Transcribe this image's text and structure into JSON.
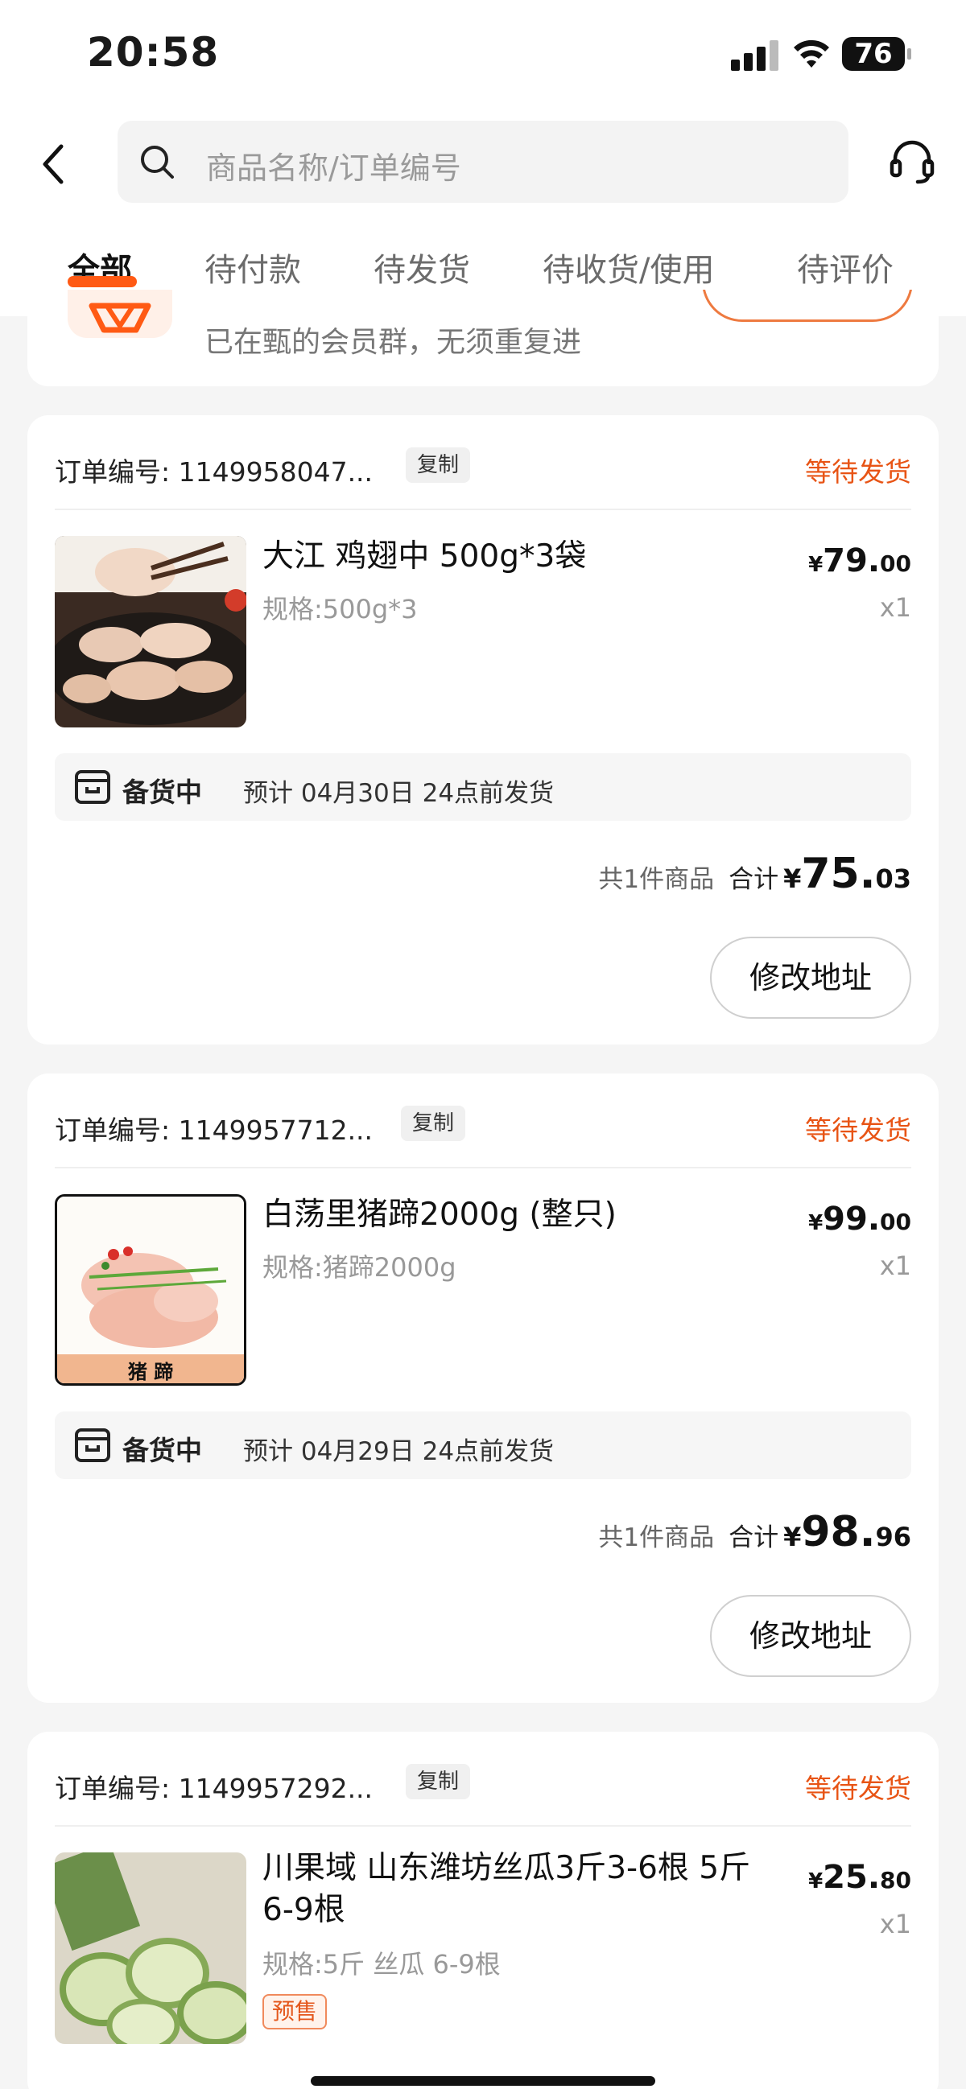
{
  "status_bar": {
    "time": "20:58",
    "battery": "76"
  },
  "search": {
    "placeholder": "商品名称/订单编号"
  },
  "tabs": [
    {
      "label": "全部",
      "active": true
    },
    {
      "label": "待付款"
    },
    {
      "label": "待发货"
    },
    {
      "label": "待收货/使用"
    },
    {
      "label": "待评价"
    }
  ],
  "member_banner": {
    "text": "已在甄的会员群，无须重复进"
  },
  "colors": {
    "accent": "#ff5a14",
    "status": "#e85415",
    "background": "#f5f5f5"
  },
  "orders": [
    {
      "order_no": "订单编号: 1149958047...",
      "copy_label": "复制",
      "status": "等待发货",
      "product": {
        "title": "大江 鸡翅中 500g*3袋",
        "spec": "规格:500g*3",
        "price_yen": "¥",
        "price_int": "79.",
        "price_cents": "00",
        "qty": "x1"
      },
      "shipping": {
        "state": "备货中",
        "eta": "预计 04月30日 24点前发货"
      },
      "summary": {
        "count": "共1件商品",
        "total_label": "合计",
        "total_yen": "¥",
        "total_int": "75.",
        "total_cents": "03"
      },
      "action": "修改地址"
    },
    {
      "order_no": "订单编号: 1149957712...",
      "copy_label": "复制",
      "status": "等待发货",
      "product": {
        "title": "白荡里猪蹄2000g (整只)",
        "spec": "规格:猪蹄2000g",
        "price_yen": "¥",
        "price_int": "99.",
        "price_cents": "00",
        "qty": "x1",
        "thumb_caption": "猪 蹄"
      },
      "shipping": {
        "state": "备货中",
        "eta": "预计 04月29日 24点前发货"
      },
      "summary": {
        "count": "共1件商品",
        "total_label": "合计",
        "total_yen": "¥",
        "total_int": "98.",
        "total_cents": "96"
      },
      "action": "修改地址"
    },
    {
      "order_no": "订单编号: 1149957292...",
      "copy_label": "复制",
      "status": "等待发货",
      "product": {
        "title_line1": "川果域 山东潍坊丝瓜3斤3-6根 5斤",
        "title_line2": "6-9根",
        "spec": "规格:5斤 丝瓜 6-9根",
        "price_yen": "¥",
        "price_int": "25.",
        "price_cents": "80",
        "qty": "x1",
        "tag": "预售"
      }
    }
  ]
}
